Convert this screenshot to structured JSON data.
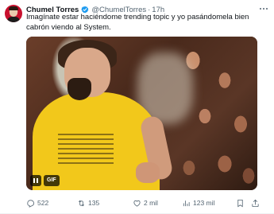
{
  "author": {
    "display_name": "Chumel Torres",
    "handle": "@ChumelTorres",
    "separator": "·",
    "timestamp": "17h",
    "verified_color": "#1d9bf0"
  },
  "tweet": {
    "text": "Imagínate estar haciéndome trending topic y yo pasándomela bien cabrón viendo al System.",
    "media": {
      "badge": "GIF",
      "controls": "pause-icon"
    }
  },
  "actions": {
    "reply": {
      "icon": "reply-icon",
      "count": "522"
    },
    "retweet": {
      "icon": "retweet-icon",
      "count": "135"
    },
    "like": {
      "icon": "heart-icon",
      "count": "2 mil"
    },
    "views": {
      "icon": "views-icon",
      "count": "123 mil"
    },
    "bookmark": {
      "icon": "bookmark-icon"
    },
    "share": {
      "icon": "share-icon"
    }
  },
  "colors": {
    "text_primary": "#0f1419",
    "text_secondary": "#536471",
    "accent": "#1d9bf0"
  }
}
